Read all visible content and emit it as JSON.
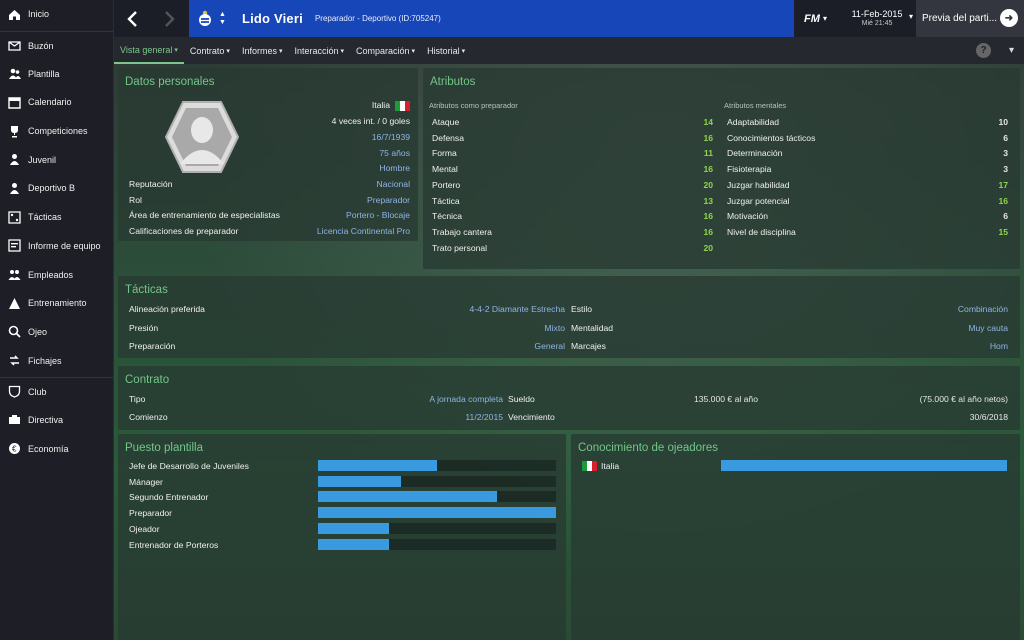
{
  "sidebar": {
    "items": [
      {
        "label": "Inicio",
        "icon": "home-icon"
      },
      {
        "label": "Buzón",
        "icon": "inbox-icon"
      },
      {
        "label": "Plantilla",
        "icon": "squad-icon"
      },
      {
        "label": "Calendario",
        "icon": "calendar-icon"
      },
      {
        "label": "Competiciones",
        "icon": "trophy-icon"
      },
      {
        "label": "Juvenil",
        "icon": "youth-icon"
      },
      {
        "label": "Deportivo B",
        "icon": "reserve-icon"
      },
      {
        "label": "Tácticas",
        "icon": "tactics-icon"
      },
      {
        "label": "Informe de equipo",
        "icon": "report-icon"
      },
      {
        "label": "Empleados",
        "icon": "staff-icon"
      },
      {
        "label": "Entrenamiento",
        "icon": "training-icon"
      },
      {
        "label": "Ojeo",
        "icon": "scouting-icon"
      },
      {
        "label": "Fichajes",
        "icon": "transfers-icon"
      },
      {
        "label": "Club",
        "icon": "club-icon"
      },
      {
        "label": "Directiva",
        "icon": "board-icon"
      },
      {
        "label": "Economía",
        "icon": "finance-icon"
      }
    ]
  },
  "header": {
    "name": "Lido Vieri",
    "subtitle": "Preparador - Deportivo (ID:705247)",
    "date": "11-Feb-2015",
    "time": "Mié 21:45",
    "continue_label": "Previa del parti..."
  },
  "tabs": [
    "Vista general",
    "Contrato",
    "Informes",
    "Interacción",
    "Comparación",
    "Historial"
  ],
  "personal": {
    "title": "Datos personales",
    "nationality": "Italia",
    "caps": "4 veces int. / 0 goles",
    "dob": "16/7/1939",
    "age": "75 años",
    "gender": "Hombre",
    "rows": [
      {
        "label": "Reputación",
        "value": "Nacional"
      },
      {
        "label": "Rol",
        "value": "Preparador"
      },
      {
        "label": "Área de entrenamiento de especialistas",
        "value": "Portero - Blocaje"
      },
      {
        "label": "Calificaciones de preparador",
        "value": "Licencia Continental Pro"
      }
    ]
  },
  "attributes": {
    "title": "Atributos",
    "coach_head": "Atributos como preparador",
    "mental_head": "Atributos mentales",
    "coach": [
      {
        "label": "Ataque",
        "value": "14"
      },
      {
        "label": "Defensa",
        "value": "16"
      },
      {
        "label": "Forma",
        "value": "11"
      },
      {
        "label": "Mental",
        "value": "16"
      },
      {
        "label": "Portero",
        "value": "20"
      },
      {
        "label": "Táctica",
        "value": "13"
      },
      {
        "label": "Técnica",
        "value": "16"
      },
      {
        "label": "Trabajo cantera",
        "value": "16"
      },
      {
        "label": "Trato personal",
        "value": "20"
      }
    ],
    "mental": [
      {
        "label": "Adaptabilidad",
        "value": "10"
      },
      {
        "label": "Conocimientos tácticos",
        "value": "6"
      },
      {
        "label": "Determinación",
        "value": "3"
      },
      {
        "label": "Fisioterapia",
        "value": "3"
      },
      {
        "label": "Juzgar habilidad",
        "value": "17"
      },
      {
        "label": "Juzgar potencial",
        "value": "16"
      },
      {
        "label": "Motivación",
        "value": "6"
      },
      {
        "label": "Nivel de disciplina",
        "value": "15"
      }
    ]
  },
  "tactics": {
    "title": "Tácticas",
    "left": [
      {
        "label": "Alineación preferida",
        "value": "4-4-2 Diamante Estrecha"
      },
      {
        "label": "Presión",
        "value": "Mixto"
      },
      {
        "label": "Preparación",
        "value": "General"
      }
    ],
    "right": [
      {
        "label": "Estilo",
        "value": "Combinación"
      },
      {
        "label": "Mentalidad",
        "value": "Muy cauta"
      },
      {
        "label": "Marcajes",
        "value": "Hom"
      }
    ]
  },
  "contract": {
    "title": "Contrato",
    "type_label": "Tipo",
    "type_value": "A jornada completa",
    "start_label": "Comienzo",
    "start_value": "11/2/2015",
    "salary_label": "Sueldo",
    "salary_value": "135.000 € al año",
    "salary_net": "(75.000 € al año netos)",
    "end_label": "Vencimiento",
    "end_value": "30/6/2018"
  },
  "positions": {
    "title": "Puesto plantilla",
    "items": [
      {
        "label": "Jefe de Desarrollo de Juveniles",
        "level": 0.5
      },
      {
        "label": "Mánager",
        "level": 0.35
      },
      {
        "label": "Segundo Entrenador",
        "level": 0.75
      },
      {
        "label": "Preparador",
        "level": 1.0
      },
      {
        "label": "Ojeador",
        "level": 0.3
      },
      {
        "label": "Entrenador de Porteros",
        "level": 0.3
      }
    ]
  },
  "scouting": {
    "title": "Conocimiento de ojeadores",
    "items": [
      {
        "label": "Italia",
        "level": 1.0
      }
    ]
  },
  "colors": {
    "accent_green": "#74c68a",
    "header_blue": "#1646b8",
    "bar_blue": "#3a9ae0",
    "value_blue": "#8fb4e6",
    "attr_green": "#8fd64a"
  }
}
